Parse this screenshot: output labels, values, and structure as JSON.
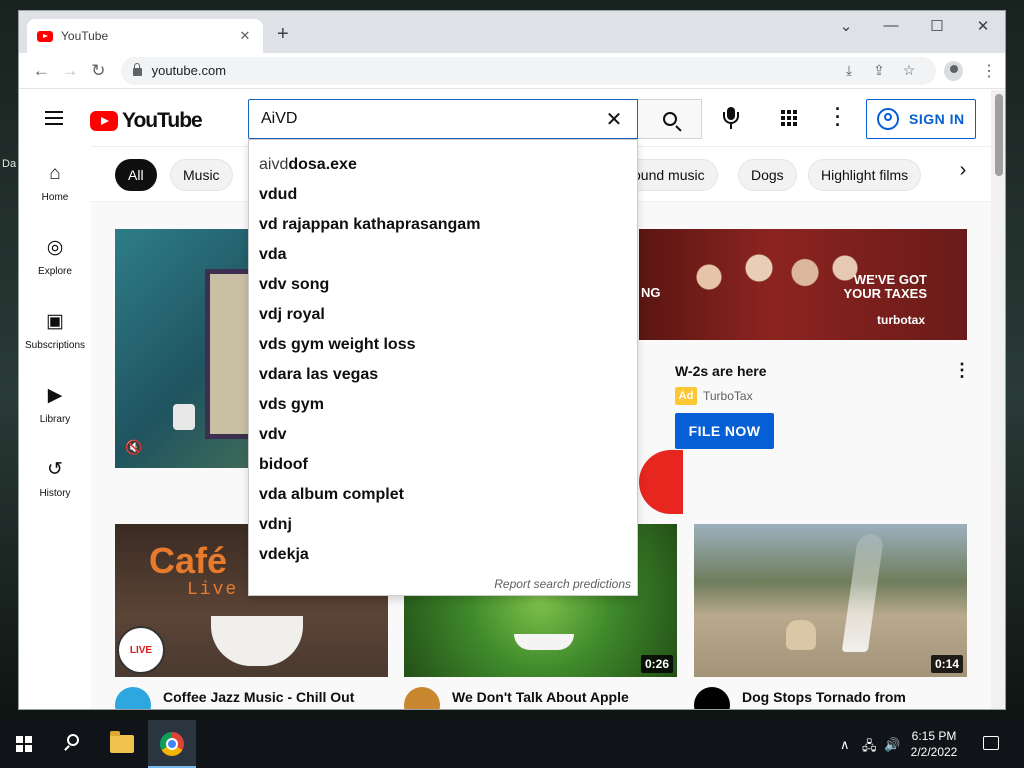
{
  "browser": {
    "tab_title": "YouTube",
    "tab_close": "✕",
    "new_tab": "+",
    "url": "youtube.com",
    "window_controls": {
      "minimize": "—",
      "maximize": "☐",
      "close": "✕",
      "dropdown": "⌄"
    },
    "nav": {
      "back": "←",
      "forward": "→",
      "reload": "↻"
    },
    "omnibox_icons": {
      "install": "⤓",
      "share": "⇪",
      "bookmark": "☆"
    },
    "menu": "⋮"
  },
  "youtube": {
    "logo_text": "YouTube",
    "search": {
      "value": "AiVD",
      "clear": "✕"
    },
    "sign_in": "SIGN IN",
    "sidebar": [
      {
        "label": "Home",
        "icon": "⌂"
      },
      {
        "label": "Explore",
        "icon": "◎"
      },
      {
        "label": "Subscriptions",
        "icon": "▣"
      },
      {
        "label": "Library",
        "icon": "▶"
      },
      {
        "label": "History",
        "icon": "↺"
      }
    ],
    "chips": [
      "All",
      "Music",
      "ound music",
      "Dogs",
      "Highlight films"
    ],
    "chip_next": "›",
    "suggestions": [
      {
        "typed": "aivd",
        "rest": " dosa.exe"
      },
      {
        "typed": "",
        "rest": "vdud"
      },
      {
        "typed": "",
        "rest": "vd rajappan kathaprasangam"
      },
      {
        "typed": "",
        "rest": "vda"
      },
      {
        "typed": "",
        "rest": "vdv song"
      },
      {
        "typed": "",
        "rest": "vdj royal"
      },
      {
        "typed": "",
        "rest": "vds gym weight loss"
      },
      {
        "typed": "",
        "rest": "vdara las vegas"
      },
      {
        "typed": "",
        "rest": "vds gym"
      },
      {
        "typed": "",
        "rest": "vdv"
      },
      {
        "typed": "",
        "rest": "bidoof"
      },
      {
        "typed": "",
        "rest": "vda album complet"
      },
      {
        "typed": "",
        "rest": "vdnj"
      },
      {
        "typed": "",
        "rest": "vdekja"
      }
    ],
    "report_predictions": "Report search predictions",
    "ad": {
      "banner_headline_1": "WE'VE GOT",
      "banner_headline_2": "YOUR TAXES",
      "banner_brand": "turbotax",
      "banner_fragment": "NG",
      "title": "W-2s are here",
      "badge": "Ad",
      "advertiser": "TurboTax",
      "cta": "FILE NOW",
      "more": "⋮"
    },
    "mute_icon": "🔇",
    "videos": [
      {
        "title": "Coffee Jazz Music - Chill Out Lounge Jazz Music Radio -",
        "thumb_text_1": "Café",
        "thumb_text_2": "Live",
        "badge": "LIVE",
        "avatar_color": "#2ea6e0"
      },
      {
        "title": "We Don't Talk About Apple Bottom Jeans",
        "duration": "0:26",
        "avatar_color": "#c9872f"
      },
      {
        "title": "Dog Stops Tornado from Forming",
        "duration": "0:14",
        "avatar_color": "#000000"
      }
    ]
  },
  "taskbar": {
    "tray_chevron": "∧",
    "tray_network": "🖧",
    "tray_volume": "🔊",
    "time": "6:15 PM",
    "date": "2/2/2022"
  },
  "desktop_fragments": [
    "Da"
  ]
}
